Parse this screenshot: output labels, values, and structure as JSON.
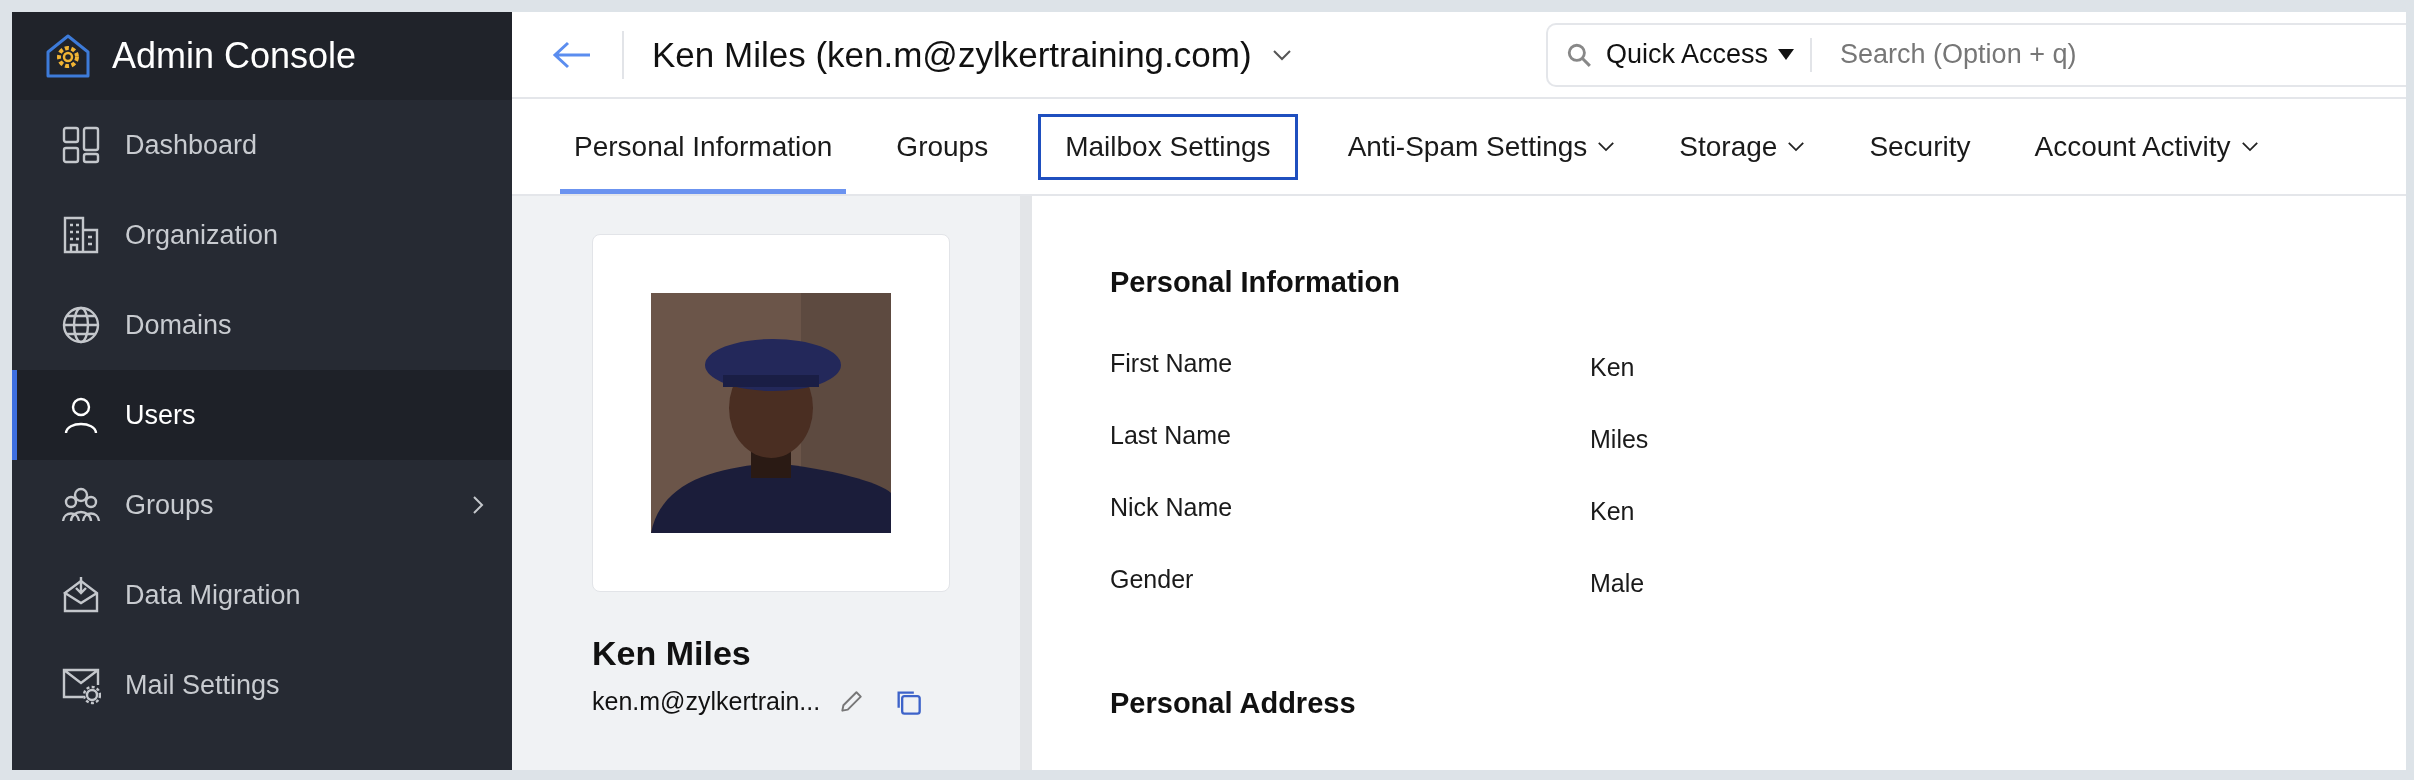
{
  "sidebar": {
    "title": "Admin Console",
    "items": [
      {
        "label": "Dashboard",
        "selected": false,
        "has_submenu": false
      },
      {
        "label": "Organization",
        "selected": false,
        "has_submenu": false
      },
      {
        "label": "Domains",
        "selected": false,
        "has_submenu": false
      },
      {
        "label": "Users",
        "selected": true,
        "has_submenu": false
      },
      {
        "label": "Groups",
        "selected": false,
        "has_submenu": true
      },
      {
        "label": "Data Migration",
        "selected": false,
        "has_submenu": false
      },
      {
        "label": "Mail Settings",
        "selected": false,
        "has_submenu": false
      }
    ]
  },
  "header": {
    "title": "Ken Miles (ken.m@zylkertraining.com)",
    "quick_access": "Quick Access",
    "search": {
      "placeholder": "Search (Option + q)"
    }
  },
  "tabs": [
    {
      "label": "Personal Information",
      "selected": true,
      "highlighted": false,
      "has_menu": false
    },
    {
      "label": "Groups",
      "selected": false,
      "highlighted": false,
      "has_menu": false
    },
    {
      "label": "Mailbox Settings",
      "selected": false,
      "highlighted": true,
      "has_menu": false
    },
    {
      "label": "Anti-Spam Settings",
      "selected": false,
      "highlighted": false,
      "has_menu": true
    },
    {
      "label": "Storage",
      "selected": false,
      "highlighted": false,
      "has_menu": true
    },
    {
      "label": "Security",
      "selected": false,
      "highlighted": false,
      "has_menu": false
    },
    {
      "label": "Account Activity",
      "selected": false,
      "highlighted": false,
      "has_menu": true
    }
  ],
  "profile": {
    "name": "Ken Miles",
    "email": "ken.m@zylkertrain..."
  },
  "sections": [
    {
      "title": "Personal Information",
      "fields": [
        {
          "label": "First Name",
          "value": "Ken"
        },
        {
          "label": "Last Name",
          "value": "Miles"
        },
        {
          "label": "Nick Name",
          "value": "Ken"
        },
        {
          "label": "Gender",
          "value": "Male"
        }
      ]
    },
    {
      "title": "Personal Address"
    }
  ]
}
